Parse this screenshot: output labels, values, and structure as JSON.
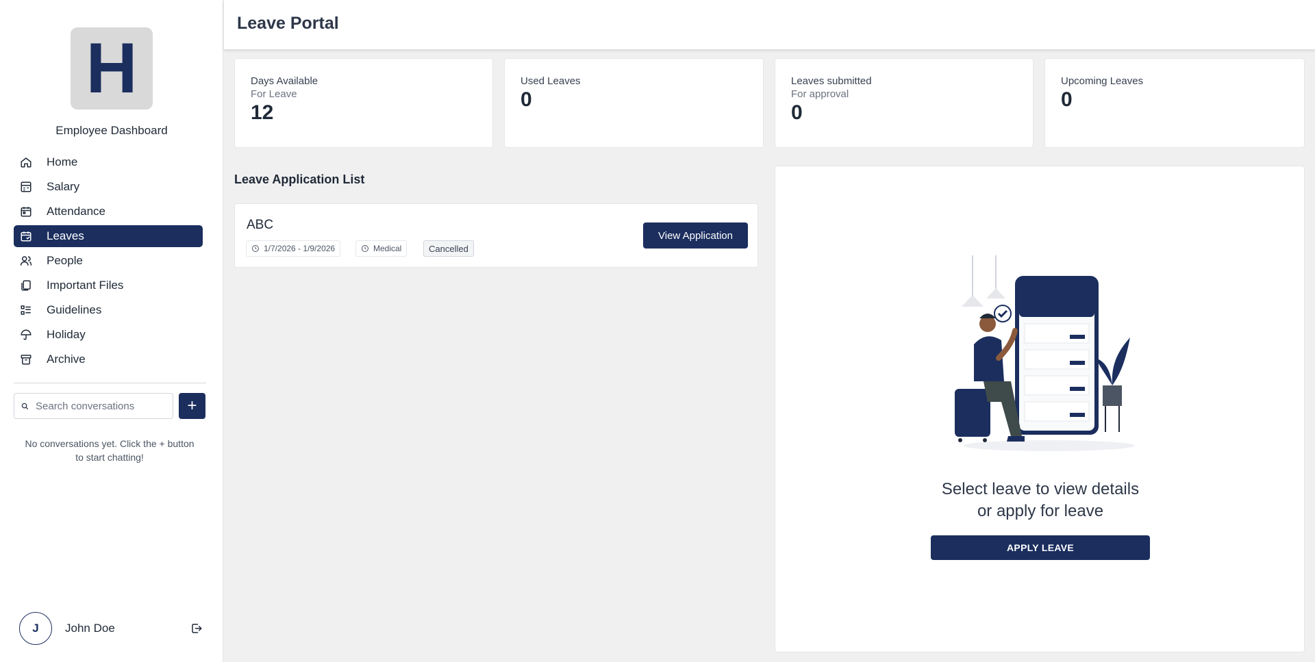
{
  "sidebar": {
    "logo_letter": "H",
    "title": "Employee Dashboard",
    "nav": [
      {
        "label": "Home",
        "icon": "home-icon",
        "active": false
      },
      {
        "label": "Salary",
        "icon": "salary-icon",
        "active": false
      },
      {
        "label": "Attendance",
        "icon": "calendar-icon",
        "active": false
      },
      {
        "label": "Leaves",
        "icon": "calendar-leave-icon",
        "active": true
      },
      {
        "label": "People",
        "icon": "people-icon",
        "active": false
      },
      {
        "label": "Important Files",
        "icon": "files-icon",
        "active": false
      },
      {
        "label": "Guidelines",
        "icon": "list-icon",
        "active": false
      },
      {
        "label": "Holiday",
        "icon": "umbrella-icon",
        "active": false
      },
      {
        "label": "Archive",
        "icon": "archive-icon",
        "active": false
      }
    ],
    "search_placeholder": "Search conversations",
    "add_label": "+",
    "empty_message": "No conversations yet. Click the + button to start chatting!",
    "user": {
      "initial": "J",
      "name": "John Doe"
    }
  },
  "header": {
    "title": "Leave Portal"
  },
  "stats": [
    {
      "label": "Days Available",
      "sub": "For Leave",
      "value": "12"
    },
    {
      "label": "Used Leaves",
      "sub": "",
      "value": "0"
    },
    {
      "label": "Leaves submitted",
      "sub": "For approval",
      "value": "0"
    },
    {
      "label": "Upcoming Leaves",
      "sub": "",
      "value": "0"
    }
  ],
  "list": {
    "title": "Leave Application List",
    "items": [
      {
        "name": "ABC",
        "dates": "1/7/2026 - 1/9/2026",
        "type": "Medical",
        "status": "Cancelled",
        "action": "View Application"
      }
    ]
  },
  "details": {
    "message_line1": "Select leave to view details",
    "message_line2": "or apply for leave",
    "apply_label": "APPLY LEAVE"
  },
  "colors": {
    "brand": "#1b2e5e",
    "background": "#f0f0f0"
  }
}
